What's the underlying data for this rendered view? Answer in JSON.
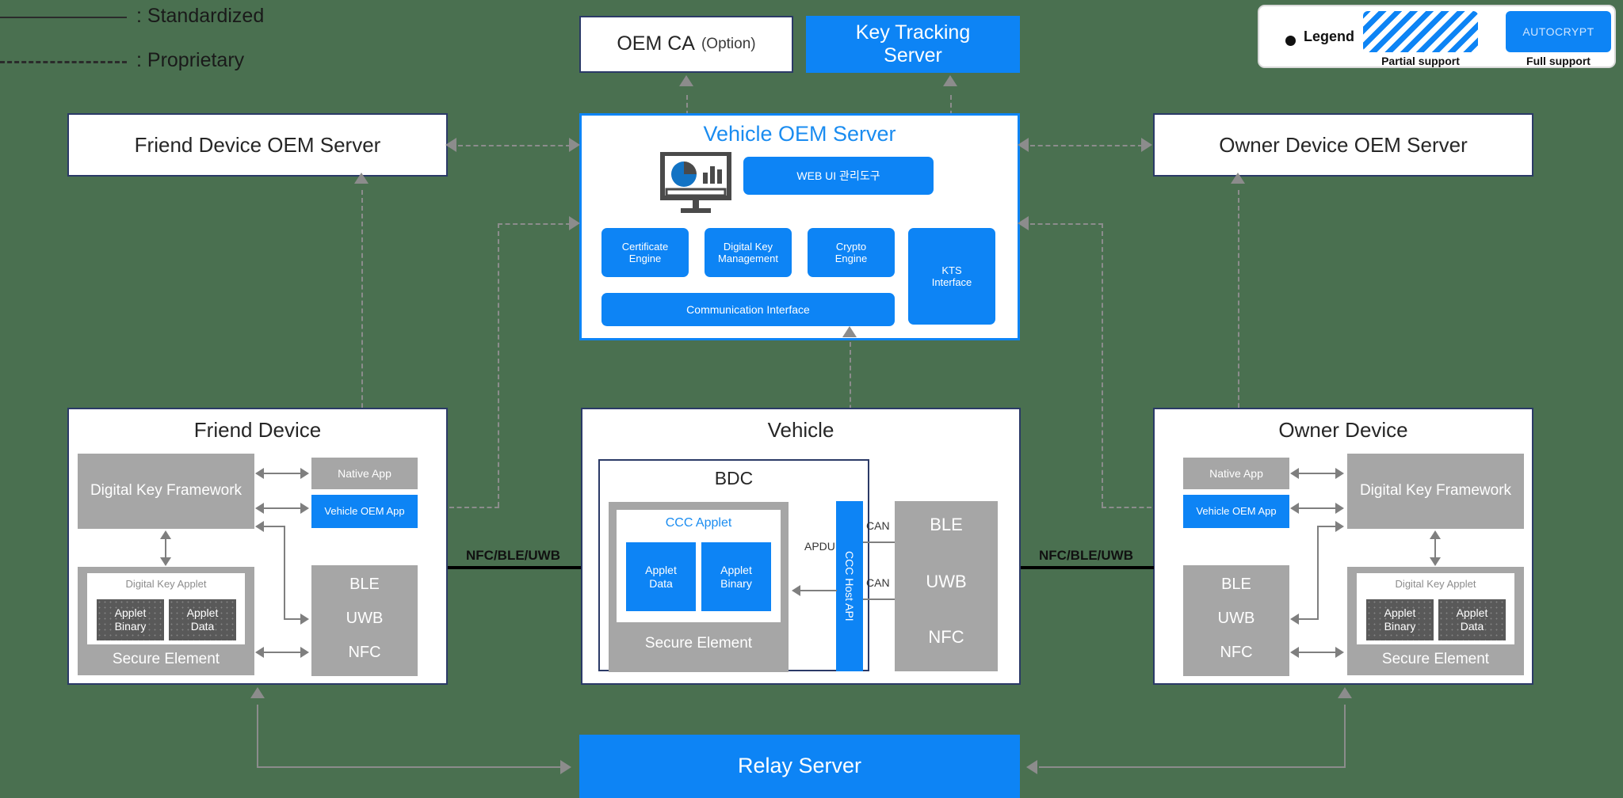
{
  "legend_lines": {
    "standardized": ": Standardized",
    "proprietary": ": Proprietary"
  },
  "legend_card": {
    "title": "Legend",
    "partial_caption": "Partial support",
    "full_caption": "Full support",
    "full_swatch_text": "AUTOCRYPT"
  },
  "top_boxes": {
    "oem_ca": "OEM CA",
    "oem_ca_option": "(Option)",
    "key_tracking_server": "Key Tracking\nServer"
  },
  "vehicle_oem_server": {
    "title": "Vehicle OEM Server",
    "web_ui": "WEB UI 관리도구",
    "certificate_engine": "Certificate\nEngine",
    "digital_key_management": "Digital Key\nManagement",
    "crypto_engine": "Crypto\nEngine",
    "kts_interface": "KTS\nInterface",
    "communication_interface": "Communication Interface"
  },
  "side_servers": {
    "friend": "Friend Device OEM Server",
    "owner": "Owner Device OEM Server"
  },
  "friend_device": {
    "title": "Friend Device",
    "digital_key_framework": "Digital Key Framework",
    "native_app": "Native App",
    "vehicle_oem_app": "Vehicle OEM App",
    "digital_key_applet": "Digital Key Applet",
    "applet_binary": "Applet\nBinary",
    "applet_data": "Applet\nData",
    "secure_element": "Secure Element",
    "radios": [
      "BLE",
      "UWB",
      "NFC"
    ]
  },
  "vehicle": {
    "title": "Vehicle",
    "bdc": "BDC",
    "ccc_applet": "CCC Applet",
    "applet_data": "Applet\nData",
    "applet_binary": "Applet\nBinary",
    "secure_element": "Secure Element",
    "ccc_host_api": "CCC Host API",
    "apdu": "APDU",
    "can_top": "CAN",
    "can_bottom": "CAN",
    "radios": [
      "BLE",
      "UWB",
      "NFC"
    ]
  },
  "owner_device": {
    "title": "Owner Device",
    "native_app": "Native App",
    "vehicle_oem_app": "Vehicle OEM App",
    "digital_key_framework": "Digital Key Framework",
    "digital_key_applet": "Digital Key Applet",
    "applet_binary": "Applet\nBinary",
    "applet_data": "Applet\nData",
    "secure_element": "Secure Element",
    "radios": [
      "BLE",
      "UWB",
      "NFC"
    ]
  },
  "relay_server": {
    "title": "Relay Server"
  },
  "edge_labels": {
    "left_link": "NFC/BLE/UWB",
    "right_link": "NFC/BLE/UWB"
  },
  "colors": {
    "accent_blue": "#0d84f5",
    "gray_block": "#a6a6a6",
    "dark_gray_block": "#595959",
    "border_navy": "#2b3a67",
    "connector_gray": "#8c8c8c",
    "background": "#4a7050"
  }
}
